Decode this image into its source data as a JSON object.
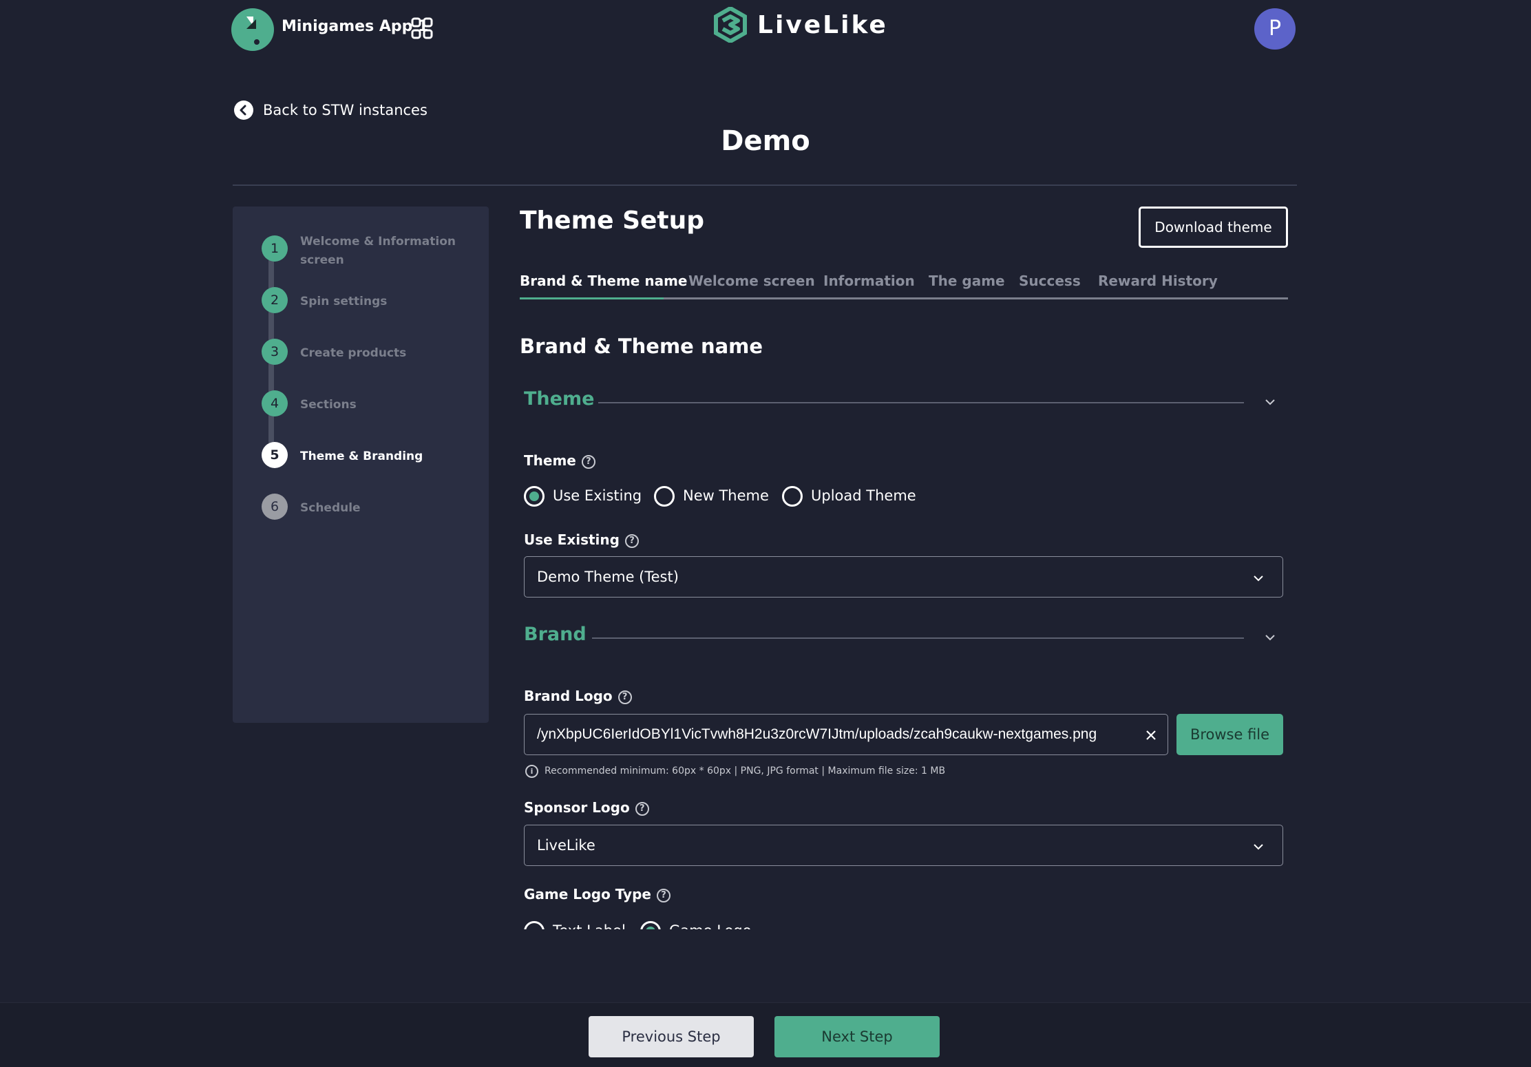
{
  "topbar": {
    "app_name": "Minigames App 1",
    "brand": "LiveLike",
    "avatar_initial": "P"
  },
  "header": {
    "back_label": "Back to STW instances",
    "title": "Demo"
  },
  "stepper": {
    "steps": [
      {
        "num": "1",
        "label": "Welcome & Information screen",
        "state": "done"
      },
      {
        "num": "2",
        "label": "Spin settings",
        "state": "done"
      },
      {
        "num": "3",
        "label": "Create products",
        "state": "done"
      },
      {
        "num": "4",
        "label": "Sections",
        "state": "done"
      },
      {
        "num": "5",
        "label": "Theme & Branding",
        "state": "active"
      },
      {
        "num": "6",
        "label": "Schedule",
        "state": "pending"
      }
    ]
  },
  "main": {
    "title": "Theme Setup",
    "download_label": "Download theme",
    "tabs": [
      {
        "label": "Brand & Theme name",
        "active": true
      },
      {
        "label": "Welcome screen",
        "active": false
      },
      {
        "label": "Information",
        "active": false
      },
      {
        "label": "The game",
        "active": false
      },
      {
        "label": "Success",
        "active": false
      },
      {
        "label": "Reward History",
        "active": false
      }
    ],
    "section_title": "Brand & Theme name",
    "theme_group": {
      "heading": "Theme",
      "theme_label": "Theme",
      "radios": [
        {
          "label": "Use Existing",
          "checked": true
        },
        {
          "label": "New Theme",
          "checked": false
        },
        {
          "label": "Upload Theme",
          "checked": false
        }
      ],
      "use_existing_label": "Use Existing",
      "use_existing_value": "Demo Theme (Test)"
    },
    "brand_group": {
      "heading": "Brand",
      "brand_logo_label": "Brand Logo",
      "brand_logo_value": "/ynXbpUC6IerIdOBYl1VicTvwh8H2u3z0rcW7IJtm/uploads/zcah9caukw-nextgames.png",
      "browse_label": "Browse file",
      "hint": "Recommended minimum: 60px * 60px | PNG, JPG format | Maximum file size: 1 MB",
      "sponsor_logo_label": "Sponsor Logo",
      "sponsor_logo_value": "LiveLike",
      "game_logo_type_label": "Game Logo Type",
      "game_logo_options": [
        {
          "label": "Text Label",
          "checked": false
        },
        {
          "label": "Game Logo",
          "checked": true
        }
      ]
    }
  },
  "footer": {
    "prev_label": "Previous Step",
    "next_label": "Next Step"
  },
  "colors": {
    "background": "#1e2130",
    "panel": "#2a2e42",
    "accent": "#4fae8e",
    "avatar": "#5c63c9"
  }
}
